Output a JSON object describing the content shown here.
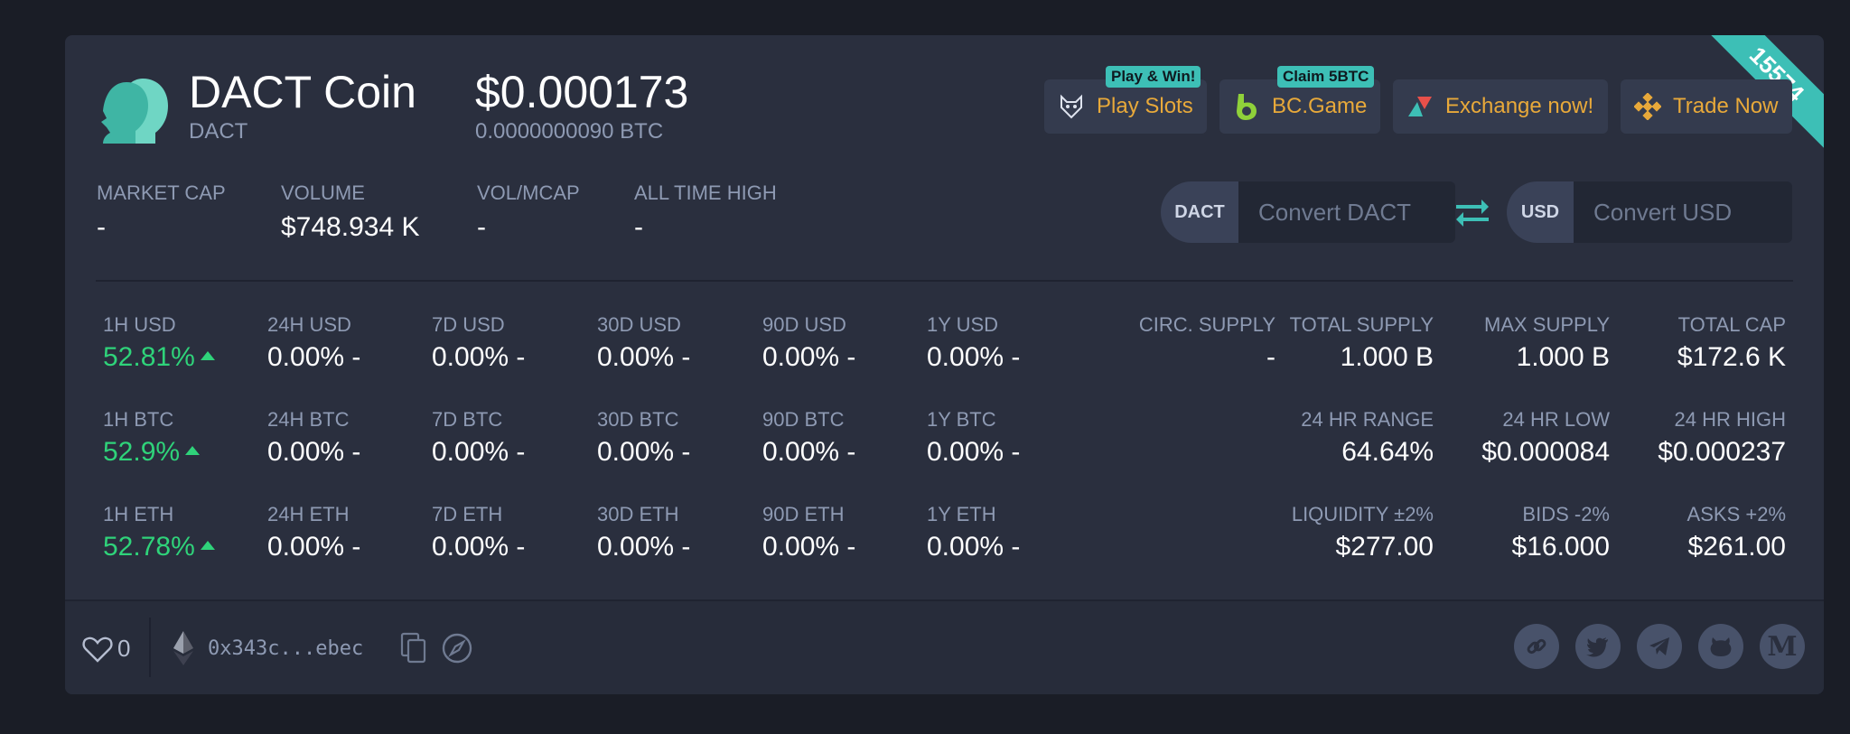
{
  "coin": {
    "name": "DACT Coin",
    "symbol": "DACT",
    "rank": "15574",
    "price_usd": "$0.000173",
    "price_btc": "0.0000000090 BTC"
  },
  "promos": [
    {
      "label": "Play Slots",
      "badge": "Play & Win!",
      "icon": "wolf-icon"
    },
    {
      "label": "BC.Game",
      "badge": "Claim 5BTC",
      "icon": "bcgame-icon"
    },
    {
      "label": "Exchange now!",
      "icon": "exchange-icon"
    },
    {
      "label": "Trade Now",
      "icon": "binance-icon"
    }
  ],
  "market": [
    {
      "label": "MARKET CAP",
      "value": "-"
    },
    {
      "label": "VOLUME",
      "value": "$748.934 K"
    },
    {
      "label": "VOL/MCAP",
      "value": "-"
    },
    {
      "label": "ALL TIME HIGH",
      "value": "-"
    }
  ],
  "converter": {
    "from_code": "DACT",
    "from_placeholder": "Convert DACT",
    "to_code": "USD",
    "to_placeholder": "Convert USD"
  },
  "perf": {
    "usd": [
      {
        "label": "1H USD",
        "value": "52.81%"
      },
      {
        "label": "24H USD",
        "value": "0.00% -"
      },
      {
        "label": "7D USD",
        "value": "0.00% -"
      },
      {
        "label": "30D USD",
        "value": "0.00% -"
      },
      {
        "label": "90D USD",
        "value": "0.00% -"
      },
      {
        "label": "1Y USD",
        "value": "0.00% -"
      }
    ],
    "btc": [
      {
        "label": "1H BTC",
        "value": "52.9%"
      },
      {
        "label": "24H BTC",
        "value": "0.00% -"
      },
      {
        "label": "7D BTC",
        "value": "0.00% -"
      },
      {
        "label": "30D BTC",
        "value": "0.00% -"
      },
      {
        "label": "90D BTC",
        "value": "0.00% -"
      },
      {
        "label": "1Y BTC",
        "value": "0.00% -"
      }
    ],
    "eth": [
      {
        "label": "1H ETH",
        "value": "52.78%"
      },
      {
        "label": "24H ETH",
        "value": "0.00% -"
      },
      {
        "label": "7D ETH",
        "value": "0.00% -"
      },
      {
        "label": "30D ETH",
        "value": "0.00% -"
      },
      {
        "label": "90D ETH",
        "value": "0.00% -"
      },
      {
        "label": "1Y ETH",
        "value": "0.00% -"
      }
    ]
  },
  "supply": {
    "circ": {
      "label": "CIRC. SUPPLY",
      "value": "-"
    },
    "total": {
      "label": "TOTAL SUPPLY",
      "value": "1.000 B"
    },
    "max": {
      "label": "MAX SUPPLY",
      "value": "1.000 B"
    },
    "cap": {
      "label": "TOTAL CAP",
      "value": "$172.6 K"
    }
  },
  "range": {
    "range24": {
      "label": "24 HR RANGE",
      "value": "64.64%"
    },
    "low24": {
      "label": "24 HR LOW",
      "value": "$0.000084"
    },
    "high24": {
      "label": "24 HR HIGH",
      "value": "$0.000237"
    }
  },
  "liquidity": {
    "liq": {
      "label": "LIQUIDITY ±2%",
      "value": "$277.00"
    },
    "bids": {
      "label": "BIDS -2%",
      "value": "$16.000"
    },
    "asks": {
      "label": "ASKS +2%",
      "value": "$261.00"
    }
  },
  "footer": {
    "likes": "0",
    "address": "0x343c...ebec"
  },
  "colors": {
    "accent": "#3dbfb6",
    "positive": "#2fd37a",
    "promo_text": "#e8a93a"
  }
}
